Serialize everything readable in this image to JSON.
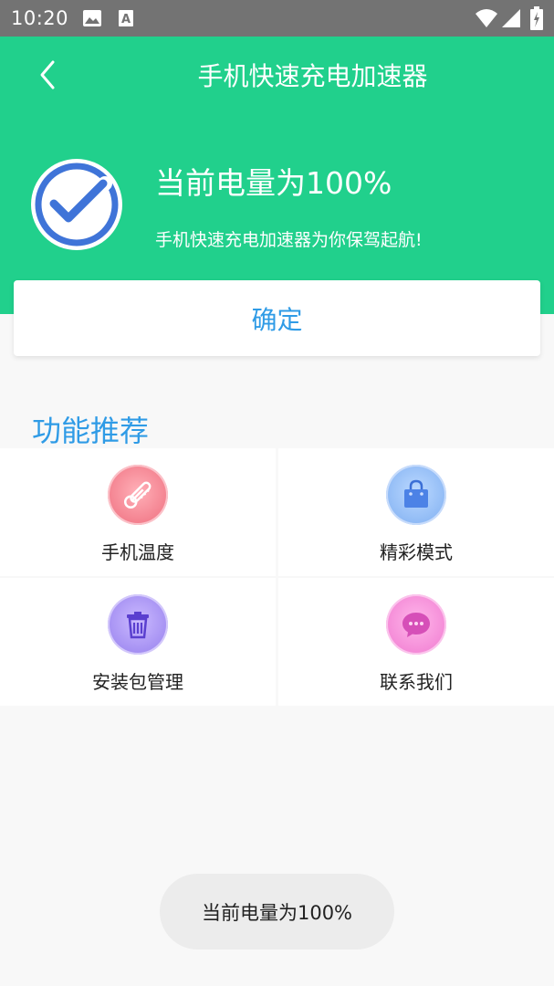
{
  "status_bar": {
    "time": "10:20",
    "icons": [
      "gallery-icon",
      "a-icon",
      "wifi-icon",
      "signal-icon",
      "battery-icon"
    ]
  },
  "header": {
    "title": "手机快速充电加速器",
    "back_icon": "chevron-left-icon",
    "status_icon": "check-circle-icon",
    "battery_text": "当前电量为100%",
    "subtitle": "手机快速充电加速器为你保驾起航!",
    "background_color": "#21d08c"
  },
  "confirm": {
    "label": "确定"
  },
  "features": {
    "title": "功能推荐",
    "items": [
      {
        "label": "手机温度",
        "icon": "thermometer-icon",
        "color": "#f3808e"
      },
      {
        "label": "精彩模式",
        "icon": "shopping-bag-icon",
        "color": "#8fbaf5"
      },
      {
        "label": "安装包管理",
        "icon": "trash-icon",
        "color": "#a48ff2"
      },
      {
        "label": "联系我们",
        "icon": "chat-bubble-icon",
        "color": "#f48ad7"
      }
    ]
  },
  "toast": {
    "text": "当前电量为100%"
  },
  "accent_color": "#2f9be6"
}
